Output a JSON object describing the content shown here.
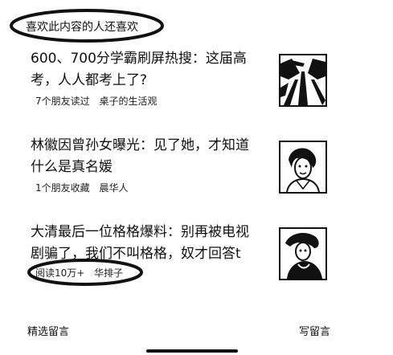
{
  "section": {
    "title": "喜欢此内容的人还喜欢"
  },
  "articles": [
    {
      "title_line1": "600、700分学霸刷屏热搜：这届高",
      "title_line2": "考，人人都考上了?",
      "meta_count": "7个朋友读过",
      "meta_source": "桌子的生活观",
      "thumb_icon": "road-photo-thumbnail"
    },
    {
      "title_line1": "林徽因曾孙女曝光：见了她，才知道",
      "title_line2": "什么是真名媛",
      "meta_count": "1个朋友收藏",
      "meta_source": "晨华人",
      "thumb_icon": "portrait-photo-thumbnail"
    },
    {
      "title_line1": "大清最后一位格格爆料：别再被电视",
      "title_line2": "剧骗了，我们不叫格格，奴才回答t",
      "meta_count": "阅读10万+",
      "meta_source": "华排子",
      "thumb_icon": "portrait-photo-thumbnail"
    }
  ],
  "footer": {
    "left_label": "精选留言",
    "right_label": "写留言"
  }
}
